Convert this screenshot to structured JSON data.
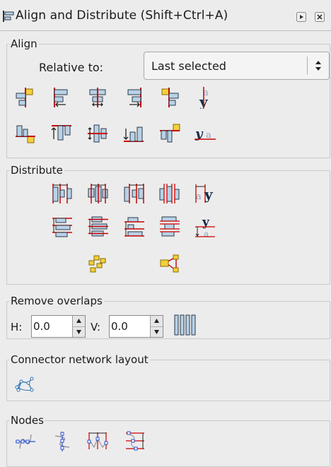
{
  "dialog": {
    "title": "Align and Distribute (Shift+Ctrl+A)"
  },
  "align": {
    "section_label": "Align",
    "relative_to_label": "Relative to:",
    "relative_to_value": "Last selected",
    "row1_icons": [
      "align-right-edge-to-left-anchor-icon",
      "align-left-edges-icon",
      "center-on-vertical-axis-icon",
      "align-right-edges-icon",
      "align-left-edge-to-right-anchor-icon",
      "align-text-baseline-horizontal-icon"
    ],
    "row2_icons": [
      "align-bottom-edge-to-top-anchor-icon",
      "align-top-edges-icon",
      "center-on-horizontal-axis-icon",
      "align-bottom-edges-icon",
      "align-top-edge-to-bottom-anchor-icon",
      "align-text-baseline-vertical-icon"
    ]
  },
  "distribute": {
    "section_label": "Distribute"
  },
  "remove_overlaps": {
    "section_label": "Remove overlaps",
    "h_label": "H:",
    "h_value": "0.0",
    "v_label": "V:",
    "v_value": "0.0"
  },
  "connector_network": {
    "section_label": "Connector network layout"
  },
  "nodes": {
    "section_label": "Nodes"
  },
  "colors": {
    "accent_red": "#cc0000",
    "box_fill": "#b9d1e6",
    "box_stroke": "#2b3a4a",
    "anchor_yellow": "#f3d13a",
    "node_blue": "#2b4fd6"
  }
}
